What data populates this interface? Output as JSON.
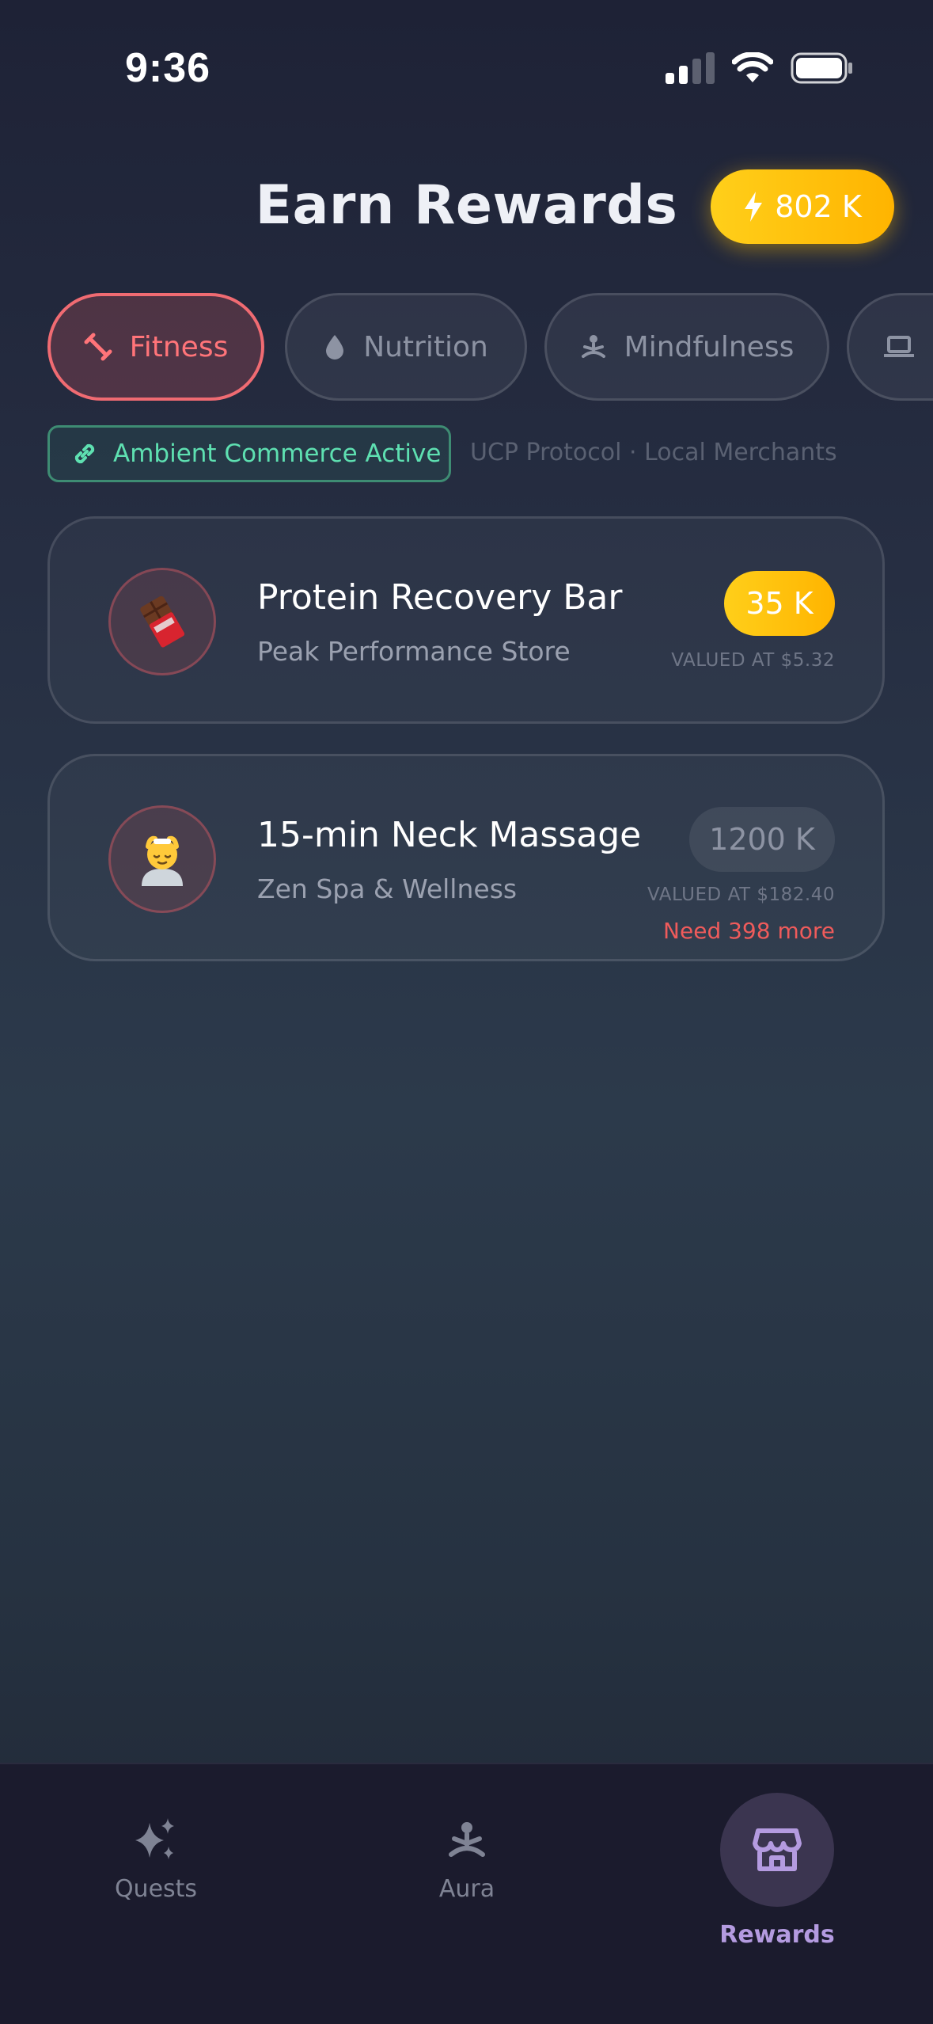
{
  "status_bar": {
    "time": "9:36"
  },
  "header": {
    "title": "Earn Rewards",
    "balance": "802 K"
  },
  "categories": [
    {
      "label": "Fitness",
      "icon": "dumbbell-icon",
      "active": true
    },
    {
      "label": "Nutrition",
      "icon": "droplet-icon",
      "active": false
    },
    {
      "label": "Mindfulness",
      "icon": "meditation-icon",
      "active": false
    },
    {
      "label": "",
      "icon": "laptop-icon",
      "active": false
    }
  ],
  "ambient": {
    "label": "Ambient Commerce Active",
    "protocol": "UCP Protocol · Local Merchants"
  },
  "rewards": [
    {
      "title": "Protein Recovery Bar",
      "merchant": "Peak Performance Store",
      "price": "35 K",
      "value": "VALUED AT $5.32",
      "icon": "chocolate-bar-icon",
      "affordable": true
    },
    {
      "title": "15-min Neck Massage",
      "merchant": "Zen Spa & Wellness",
      "price": "1200 K",
      "value": "VALUED AT $182.40",
      "need": "Need 398 more",
      "icon": "massage-icon",
      "affordable": false
    }
  ],
  "nav": {
    "items": [
      {
        "label": "Quests",
        "icon": "sparkles-icon"
      },
      {
        "label": "Aura",
        "icon": "meditation-icon"
      },
      {
        "label": "Rewards",
        "icon": "store-icon",
        "active": true
      }
    ]
  },
  "colors": {
    "accent_gold": "#FFC107",
    "active_chip": "#F06B72",
    "ambient_green": "#5EE0B1",
    "warning_red": "#EF5B5B",
    "nav_active": "#B49BE0"
  }
}
